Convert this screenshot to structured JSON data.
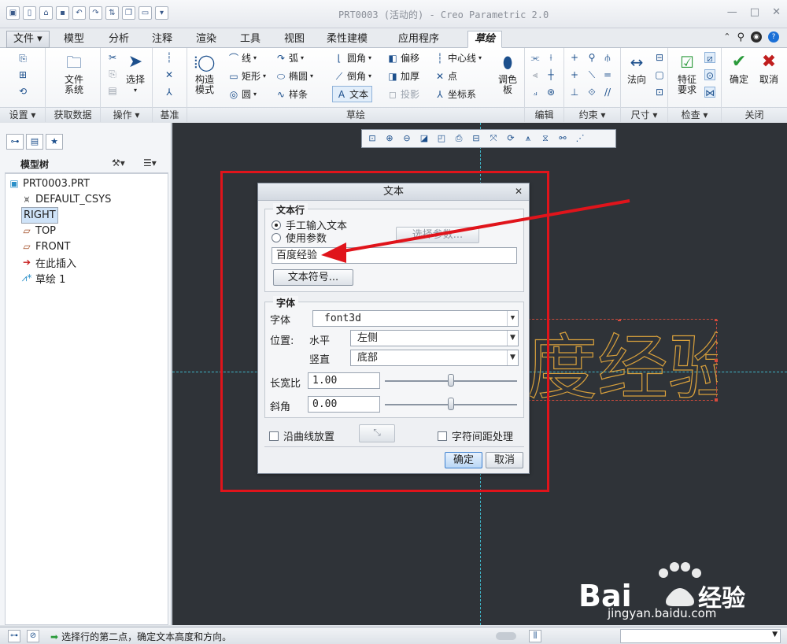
{
  "window": {
    "title": "PRT0003 (活动的) - Creo Parametric 2.0"
  },
  "quick_access": {
    "icons": [
      "new-icon",
      "open-icon",
      "save-icon",
      "undo-icon",
      "redo-icon",
      "regenerate-icon",
      "windows-icon",
      "close-icon"
    ]
  },
  "tabs": [
    {
      "label": "文件"
    },
    {
      "label": "模型"
    },
    {
      "label": "分析"
    },
    {
      "label": "注释"
    },
    {
      "label": "渲染"
    },
    {
      "label": "工具"
    },
    {
      "label": "视图"
    },
    {
      "label": "柔性建模"
    },
    {
      "label": "应用程序"
    },
    {
      "label": "草绘"
    }
  ],
  "ribbon": {
    "groups": {
      "setup": "设置",
      "get_data": "获取数据",
      "operations": "操作",
      "datum": "基准",
      "sketch": "草绘",
      "edit": "编辑",
      "constrain": "约束",
      "dimension": "尺寸",
      "inspect": "检查",
      "close": "关闭"
    },
    "buttons": {
      "file_system_1": "文件",
      "file_system_2": "系统",
      "select": "选择",
      "construct_1": "构造",
      "construct_2": "模式",
      "line": "线",
      "rectangle": "矩形",
      "circle": "圆",
      "arc": "弧",
      "ellipse": "椭圆",
      "spline": "样条",
      "fillet": "圆角",
      "chamfer": "倒角",
      "text": "文本",
      "offset": "偏移",
      "thicken": "加厚",
      "project": "投影",
      "centerline": "中心线",
      "point": "点",
      "coord_sys": "坐标系",
      "palette_1": "调色",
      "palette_2": "板",
      "normal": "法向",
      "feature_req_1": "特征",
      "feature_req_2": "要求",
      "ok": "确定",
      "cancel": "取消"
    }
  },
  "model_tree": {
    "title": "模型树",
    "items": [
      {
        "label": "PRT0003.PRT",
        "icon": "part-icon"
      },
      {
        "label": "DEFAULT_CSYS",
        "icon": "csys-icon"
      },
      {
        "label": "RIGHT",
        "icon": "datum-plane-icon"
      },
      {
        "label": "TOP",
        "icon": "datum-plane-icon"
      },
      {
        "label": "FRONT",
        "icon": "datum-plane-icon"
      },
      {
        "label": "在此插入",
        "icon": "insert-arrow-icon"
      },
      {
        "label": "草绘 1",
        "icon": "sketch-icon"
      }
    ]
  },
  "dialog": {
    "title": "文本",
    "text_line_section": "文本行",
    "radio_manual": "手工输入文本",
    "radio_param": "使用参数",
    "select_param_button": "选择参数...",
    "text_value": "百度经验",
    "text_symbol_button": "文本符号...",
    "font_section": "字体",
    "font_label": "字体",
    "font_value": "font3d",
    "position_label": "位置:",
    "horizontal_label": "水平",
    "horizontal_value": "左侧",
    "vertical_label": "竖直",
    "vertical_value": "底部",
    "aspect_label": "长宽比",
    "aspect_value": "1.00",
    "aspect_fraction": 0.5,
    "slant_label": "斜角",
    "slant_value": "0.00",
    "slant_fraction": 0.5,
    "along_curve": "沿曲线放置",
    "kerning": "字符间距处理",
    "ok_button": "确定",
    "cancel_button": "取消"
  },
  "sketch_preview": {
    "text": "度经验"
  },
  "status": {
    "message": "选择行的第二点，确定文本高度和方向。"
  },
  "watermark": {
    "brand_a": "Bai",
    "brand_b": "经验",
    "url": "jingyan.baidu.com"
  },
  "colors": {
    "accent_red": "#e0141b",
    "sketch_text": "#d8a03c",
    "canvas": "#2f3338",
    "axis": "#3fb5c8"
  }
}
